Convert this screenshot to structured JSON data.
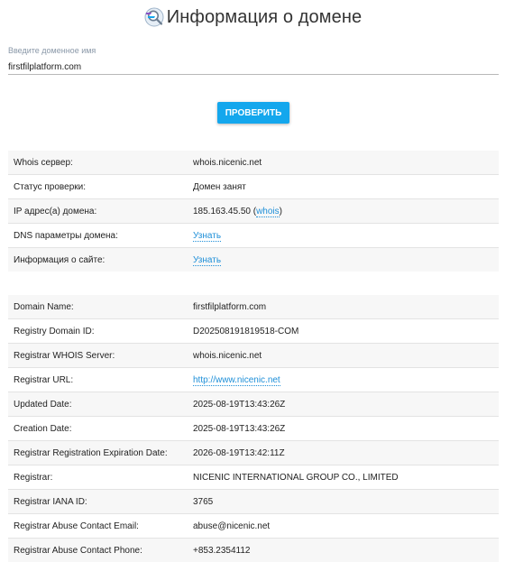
{
  "header": {
    "title": "Информация о домене",
    "icon": "domain-magnifier-icon"
  },
  "form": {
    "label": "Введите доменное имя",
    "value": "firstfilplatform.com",
    "button": "ПРОВЕРИТЬ"
  },
  "summary": {
    "whois_server": {
      "key": "Whois сервер:",
      "value": "whois.nicenic.net"
    },
    "status": {
      "key": "Статус проверки:",
      "value": "Домен занят"
    },
    "ip": {
      "key": "IP адрес(а) домена:",
      "value": "185.163.45.50",
      "paren_open": " (",
      "link": "whois",
      "paren_close": ")"
    },
    "dns": {
      "key": "DNS параметры домена:",
      "link": "Узнать"
    },
    "site": {
      "key": "Информация о сайте:",
      "link": "Узнать"
    }
  },
  "registry": [
    {
      "key": "Domain Name:",
      "value": "firstfilplatform.com"
    },
    {
      "key": "Registry Domain ID:",
      "value": "D202508191819518-COM"
    },
    {
      "key": "Registrar WHOIS Server:",
      "value": "whois.nicenic.net"
    },
    {
      "key": "Registrar URL:",
      "value": "http://www.nicenic.net",
      "is_link": true
    },
    {
      "key": "Updated Date:",
      "value": "2025-08-19T13:43:26Z"
    },
    {
      "key": "Creation Date:",
      "value": "2025-08-19T13:43:26Z"
    },
    {
      "key": "Registrar Registration Expiration Date:",
      "value": "2026-08-19T13:42:11Z"
    },
    {
      "key": "Registrar:",
      "value": "NICENIC INTERNATIONAL GROUP CO., LIMITED"
    },
    {
      "key": "Registrar IANA ID:",
      "value": "3765"
    },
    {
      "key": "Registrar Abuse Contact Email:",
      "value": "abuse@nicenic.net"
    },
    {
      "key": "Registrar Abuse Contact Phone:",
      "value": "+853.2354112"
    }
  ],
  "colors": {
    "accent": "#14a7ed",
    "link": "#1e8fd8",
    "stripe": "#f7f7f7"
  }
}
